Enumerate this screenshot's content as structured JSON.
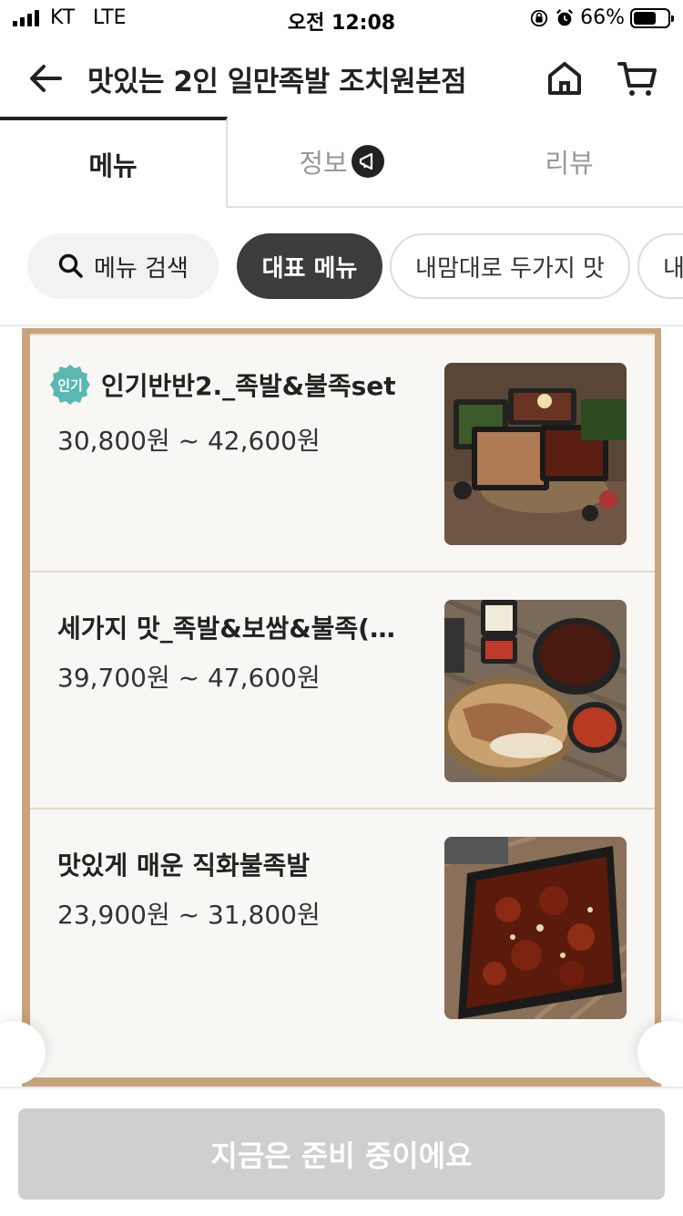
{
  "status_bar": {
    "carrier": "KT",
    "network": "LTE",
    "time": "오전 12:08",
    "battery": "66%"
  },
  "header": {
    "title": "맛있는 2인 일만족발 조치원본점",
    "back_icon": "arrow-left-icon",
    "home_icon": "home-icon",
    "cart_icon": "cart-icon"
  },
  "tabs": [
    {
      "label": "메뉴",
      "active": true
    },
    {
      "label": "정보",
      "active": false
    },
    {
      "label": "리뷰",
      "active": false
    }
  ],
  "chips": {
    "search": "메뉴 검색",
    "items": [
      "대표 메뉴",
      "내맘대로 두가지 맛",
      "내"
    ]
  },
  "menu_items": [
    {
      "badge": "인기",
      "name": "인기반반2._족발&불족set",
      "price": "30,800원 ~ 42,600원"
    },
    {
      "badge": "",
      "name": "세가지 맛_족발&보쌈&불족(…",
      "price": "39,700원 ~ 47,600원"
    },
    {
      "badge": "",
      "name": "맛있게 매운 직화불족발",
      "price": "23,900원 ~ 31,800원"
    }
  ],
  "footer": {
    "button_label": "지금은 준비 중이에요"
  },
  "colors": {
    "board_frame": "#c7a57c",
    "active_chip": "#3c3c3c",
    "badge_teal": "#5bb8b0",
    "disabled_button": "#cfcfcf"
  }
}
